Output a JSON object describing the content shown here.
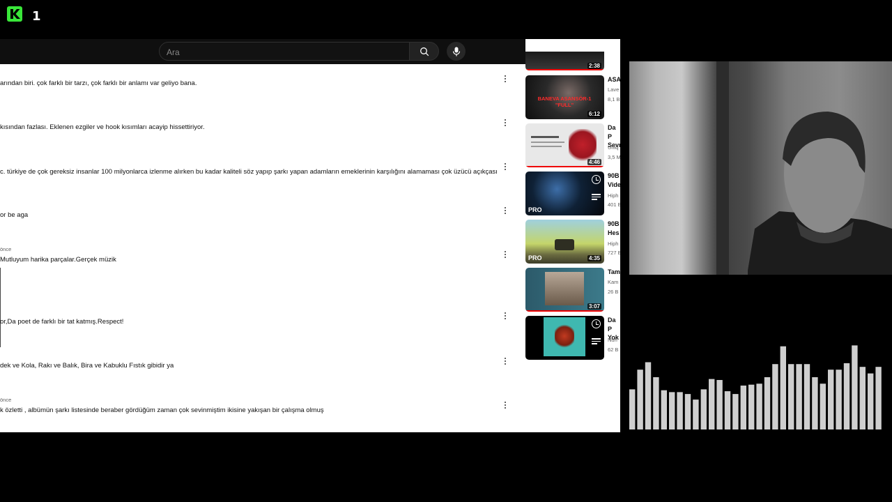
{
  "channel": {
    "logo_letter": "K",
    "logo_number": "1",
    "brand_color": "#39e639"
  },
  "search": {
    "placeholder": "Ara"
  },
  "comments": [
    {
      "meta": "",
      "text": "arından biri. çok farklı bir tarzı, çok farklı bir anlamı var geliyo bana."
    },
    {
      "meta": "",
      "text": "kısından fazlası. Eklenen ezgiler ve hook kısımları acayip hissettiriyor."
    },
    {
      "meta": "",
      "text": "c. türkiye de çok gereksiz insanlar 100 milyonlarca izlenme alırken bu kadar kaliteli söz yapıp şarkı yapan adamların emeklerinin karşılığını alamaması çok üzücü açıkçası"
    },
    {
      "meta": "",
      "text": "or be aga"
    },
    {
      "meta": "önce",
      "text": "Mutluyum harika parçalar.Gerçek müzik"
    },
    {
      "meta": "",
      "text": "or,Da poet de farklı bir tat katmış.Respect!"
    },
    {
      "meta": "",
      "text": "dek ve Kola, Rakı ve Balık, Bira ve Kabuklu Fıstık gibidir ya"
    },
    {
      "meta": "önce",
      "text": "k özletti , albümün şarkı listesinde beraber gördüğüm zaman çok sevinmiştim ikisine yakışan bir çalışma olmuş"
    }
  ],
  "recommended": [
    {
      "title": "",
      "channel": "",
      "stats": "",
      "duration": "2:38",
      "thumb_label": ""
    },
    {
      "title": "ASA",
      "channel": "Lave",
      "stats": "8,1 B",
      "duration": "6:12",
      "thumb_label": "BANEVA ASANSÖR-1 \"FULL\""
    },
    {
      "title": "Da P Sevr",
      "channel": "Uniq",
      "stats": "3,5 M",
      "duration": "4:46",
      "thumb_label": ""
    },
    {
      "title": "90B Vide",
      "channel": "Hiph",
      "stats": "401 E",
      "duration": "",
      "thumb_label": "PRO"
    },
    {
      "title": "90B Hes",
      "channel": "Hiph",
      "stats": "727 E",
      "duration": "4:35",
      "thumb_label": "PRO"
    },
    {
      "title": "Tam",
      "channel": "Kam",
      "stats": "26 B",
      "duration": "3:07",
      "thumb_label": ""
    },
    {
      "title": "Da P Yok",
      "channel": "Nuh",
      "stats": "62 B",
      "duration": "",
      "thumb_label": ""
    }
  ],
  "visualizer": {
    "bar_color": "#cfcfcf",
    "levels": [
      0.43,
      0.64,
      0.72,
      0.56,
      0.42,
      0.4,
      0.4,
      0.38,
      0.32,
      0.43,
      0.54,
      0.53,
      0.41,
      0.38,
      0.47,
      0.48,
      0.49,
      0.56,
      0.7,
      0.89,
      0.7,
      0.7,
      0.7,
      0.56,
      0.49,
      0.64,
      0.64,
      0.71,
      0.9,
      0.67,
      0.6,
      0.67
    ]
  }
}
